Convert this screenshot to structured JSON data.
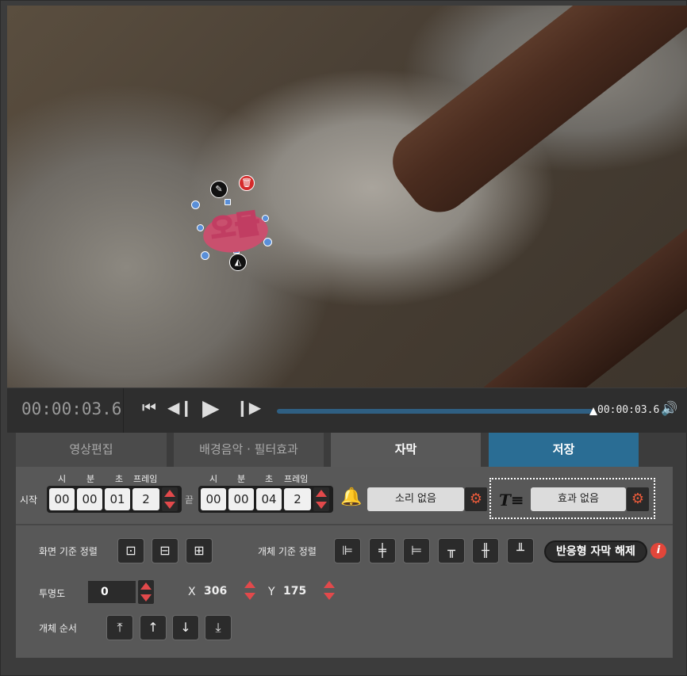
{
  "video": {
    "sticker_text": "오물"
  },
  "transport": {
    "current_time": "00:00:03.6",
    "end_time": "00:00:03.6",
    "progress": 1.0,
    "icons": [
      "skip-start-icon",
      "prev-frame-icon",
      "play-icon",
      "next-frame-icon",
      "volume-icon"
    ]
  },
  "tabs": [
    {
      "label": "영상편집"
    },
    {
      "label": "배경음악 · 필터효과"
    },
    {
      "label": "자막"
    },
    {
      "label": "저장"
    }
  ],
  "timing": {
    "start_label": "시작",
    "end_label": "끝",
    "headers": [
      "시",
      "분",
      "초",
      "프레임"
    ],
    "start": [
      "00",
      "00",
      "01",
      "2"
    ],
    "end": [
      "00",
      "00",
      "04",
      "2"
    ]
  },
  "sound": {
    "label": "소리 없음"
  },
  "effect": {
    "label": "효과 없음"
  },
  "screen_align": {
    "label": "화면 기준 정렬"
  },
  "object_align": {
    "label": "개체 기준 정렬"
  },
  "responsive": {
    "label": "반응형 자막 해제"
  },
  "opacity": {
    "label": "투명도",
    "value": "0"
  },
  "position": {
    "x_label": "X",
    "x_value": "306",
    "y_label": "Y",
    "y_value": "175"
  },
  "order": {
    "label": "개체 순서"
  },
  "colors": {
    "accent_blue": "#2a6d94",
    "spin_red": "#e2494b",
    "gear_orange": "#e85a3a"
  }
}
